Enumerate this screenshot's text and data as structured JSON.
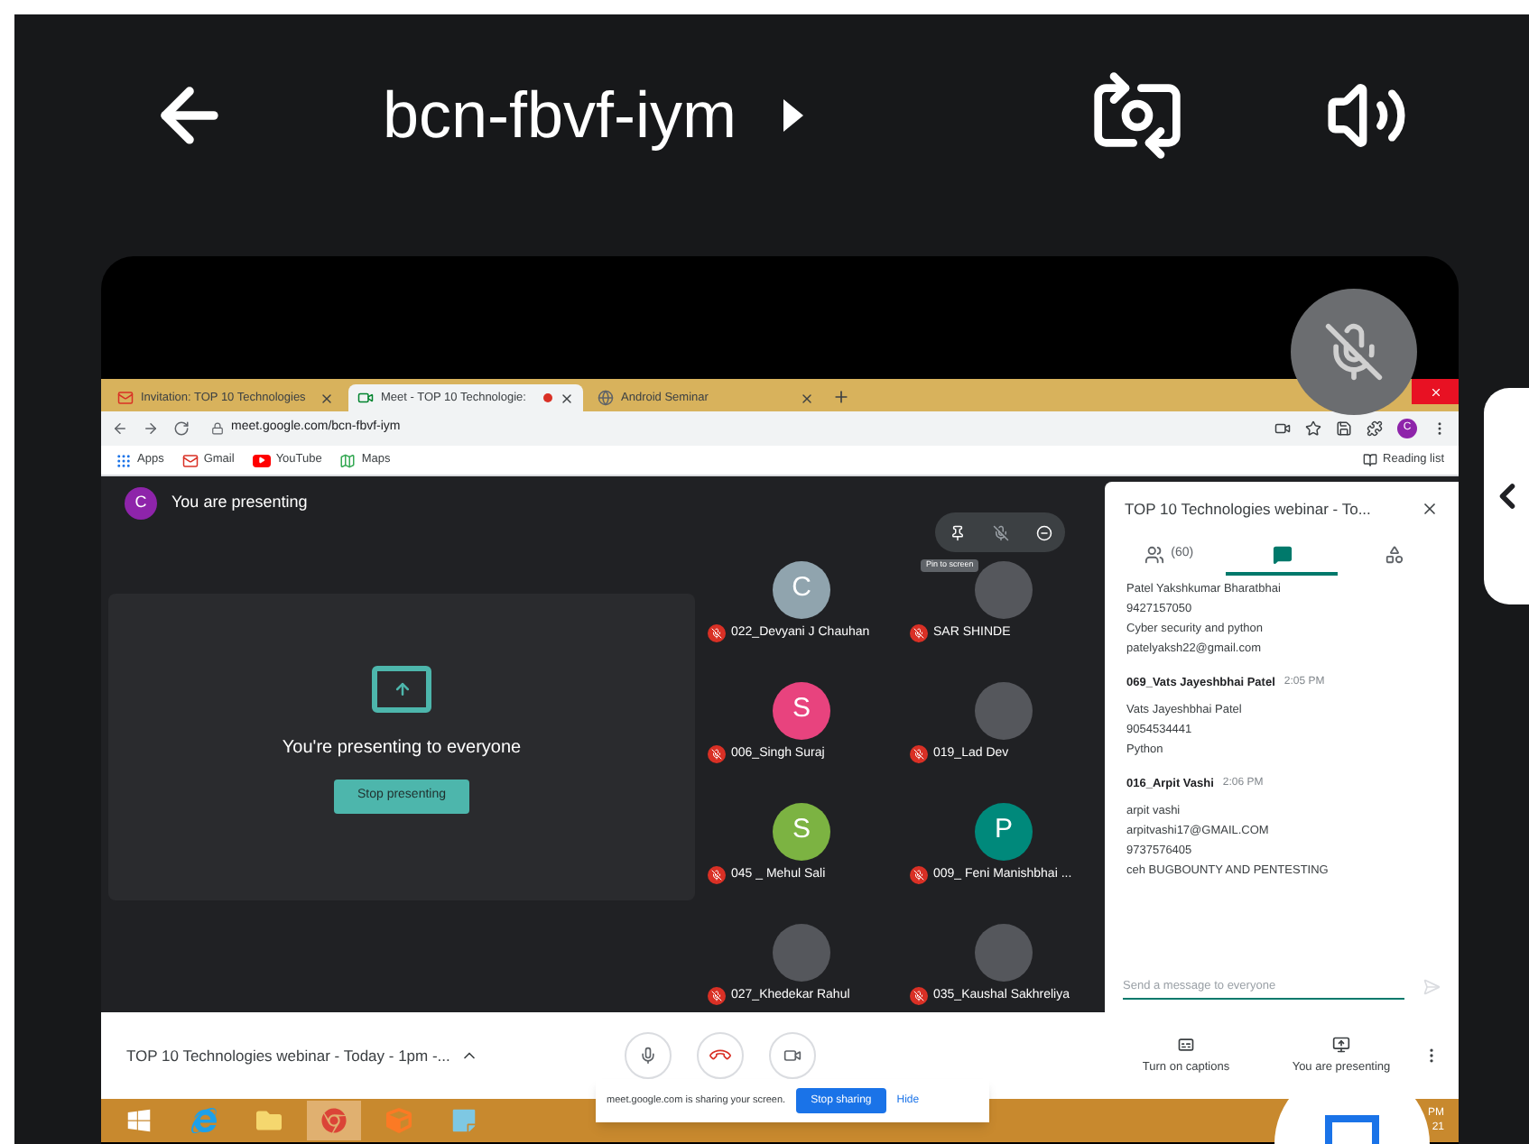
{
  "header": {
    "title": "bcn-fbvf-iym"
  },
  "browser": {
    "tabs": [
      {
        "kind": "mail",
        "label": "Invitation: TOP 10 Technologies",
        "selected": false,
        "recording": false
      },
      {
        "kind": "meet",
        "label": "Meet - TOP 10 Technologie:",
        "selected": true,
        "recording": true
      },
      {
        "kind": "web",
        "label": "Android Seminar",
        "selected": false,
        "recording": false
      }
    ],
    "address": "meet.google.com/bcn-fbvf-iym",
    "avatar": "C",
    "bookmarks": [
      {
        "kind": "apps",
        "label": "Apps"
      },
      {
        "kind": "mail",
        "label": "Gmail"
      },
      {
        "kind": "video",
        "label": "YouTube"
      },
      {
        "kind": "map",
        "label": "Maps"
      }
    ],
    "reading_list": "Reading list"
  },
  "meet": {
    "presenter": {
      "avatar": "C",
      "label": "You are presenting"
    },
    "presenting_card": {
      "message": "You're presenting to everyone",
      "button": "Stop presenting"
    },
    "participants": [
      {
        "kind": "letter",
        "avatar": "C",
        "color": "#90a4ae",
        "name": "022_Devyani J Chauhan",
        "muted": true
      },
      {
        "kind": "photo",
        "name": "SAR SHINDE",
        "muted": true
      },
      {
        "kind": "letter",
        "avatar": "S",
        "color": "#e8437e",
        "name": "006_Singh Suraj",
        "muted": true
      },
      {
        "kind": "photo",
        "name": "019_Lad Dev",
        "muted": true
      },
      {
        "kind": "letter",
        "avatar": "S",
        "color": "#7cb342",
        "name": "045 _ Mehul Sali",
        "muted": true
      },
      {
        "kind": "letter",
        "avatar": "P",
        "color": "#00897b",
        "name": "009_ Feni Manishbhai ...",
        "muted": true
      },
      {
        "kind": "photo",
        "name": "027_Khedekar Rahul",
        "muted": true
      },
      {
        "kind": "photo",
        "name": "035_Kaushal Sakhreliya",
        "muted": true
      }
    ],
    "tooltip": "Pin to screen",
    "chat": {
      "title": "TOP 10 Technologies webinar - To...",
      "panel_tabs": [
        {
          "kind": "people",
          "label": "(60)",
          "selected": false
        },
        {
          "kind": "chat",
          "selected": true
        },
        {
          "kind": "activities",
          "selected": false
        }
      ],
      "messages": [
        {
          "lines": [
            "Patel Yakshkumar Bharatbhai",
            "9427157050",
            "Cyber security and python",
            "patelyaksh22@gmail.com"
          ]
        },
        {
          "sender": "069_Vats Jayeshbhai Patel",
          "time": "2:05 PM",
          "lines": [
            "Vats Jayeshbhai Patel",
            "9054534441",
            "Python"
          ]
        },
        {
          "sender": "016_Arpit Vashi",
          "time": "2:06 PM",
          "lines": [
            "arpit vashi",
            "arpitvashi17@GMAIL.COM",
            "9737576405",
            "ceh BUGBOUNTY AND PENTESTING"
          ]
        }
      ],
      "placeholder": "Send a message to everyone"
    },
    "bottom_bar": {
      "meeting_title": "TOP 10 Technologies webinar - Today - 1pm -...",
      "captions": "Turn on captions",
      "presenting": "You are presenting"
    }
  },
  "sharing_bar": {
    "message": "meet.google.com is sharing your screen.",
    "stop": "Stop sharing",
    "hide": "Hide"
  },
  "taskbar": {
    "apps": [
      {
        "kind": "start"
      },
      {
        "kind": "ie"
      },
      {
        "kind": "folder"
      },
      {
        "kind": "chrome",
        "selected": true
      },
      {
        "kind": "xampp"
      },
      {
        "kind": "notepad"
      }
    ],
    "clock": [
      "PM",
      "21"
    ]
  }
}
